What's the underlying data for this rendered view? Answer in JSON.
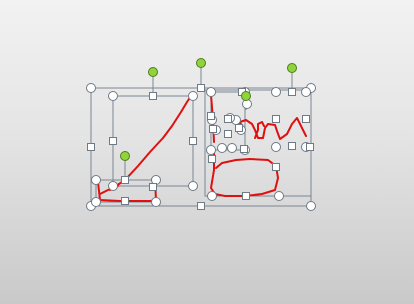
{
  "colors": {
    "ink": "#e01010",
    "rotate_handle": "#8fd43a",
    "selection_frame": "#7a8693",
    "handle_fill": "#ffffff"
  },
  "selection": {
    "shape_count": 4,
    "shapes": [
      {
        "name": "ink-stroke-outer-box",
        "kind": "ink-drawing"
      },
      {
        "name": "ink-stroke-diagonal",
        "kind": "ink-drawing"
      },
      {
        "name": "ink-stroke-small-box",
        "kind": "ink-drawing"
      },
      {
        "name": "ink-stroke-right-glyph",
        "kind": "ink-drawing"
      }
    ]
  },
  "icons": {
    "rotate": "rotate-handle-icon",
    "resize_corner": "resize-handle-corner-icon",
    "resize_side": "resize-handle-side-icon"
  }
}
